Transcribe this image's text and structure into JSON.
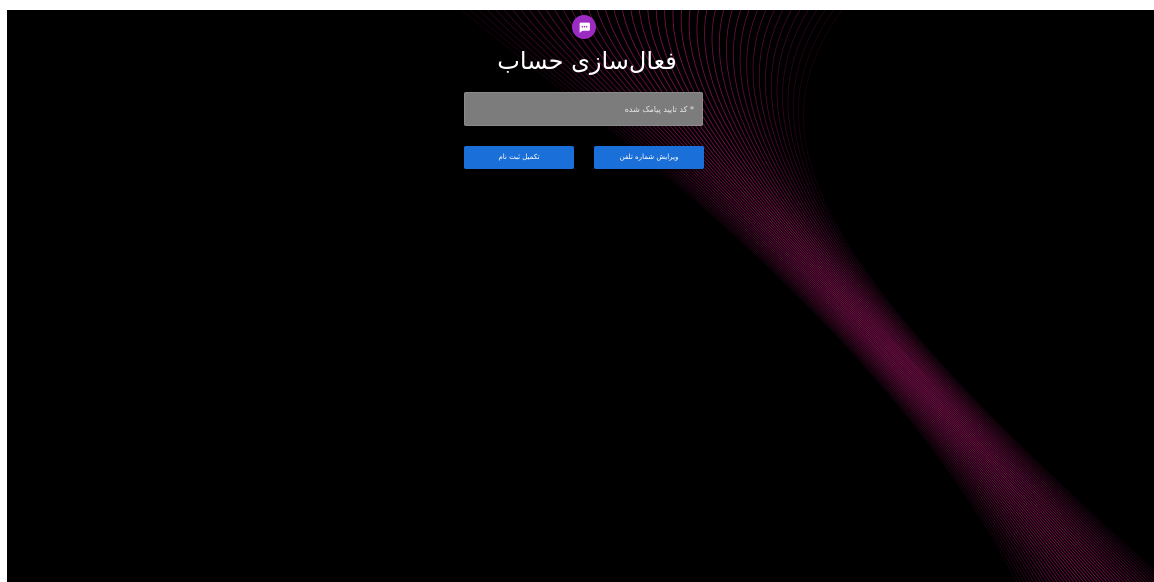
{
  "page": {
    "title": "فعال‌سازی حساب",
    "logo_icon": "chat-bubble-icon"
  },
  "form": {
    "code_placeholder": "* کد تایید پیامک شده",
    "code_value": ""
  },
  "buttons": {
    "complete_label": "تکمیل ثبت نام",
    "edit_phone_label": "ویرایش شماره تلفن"
  },
  "colors": {
    "background": "#000000",
    "logo": "#9c2bc4",
    "button": "#1a6fd8",
    "input": "#7c7c7c",
    "wave": "#c21878"
  }
}
